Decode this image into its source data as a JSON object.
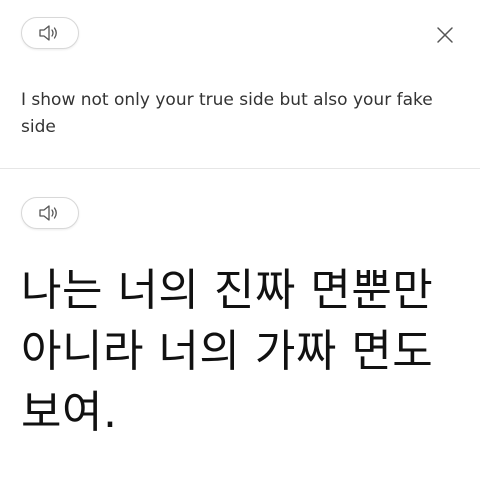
{
  "source": {
    "speaker_icon": "speaker-icon",
    "close_icon": "close-icon",
    "text": "I show not only your true side but also your fake side"
  },
  "translation": {
    "speaker_icon": "speaker-icon",
    "text": "나는 너의 진짜 면뿐만 아니라 너의 가짜 면도 보여."
  }
}
